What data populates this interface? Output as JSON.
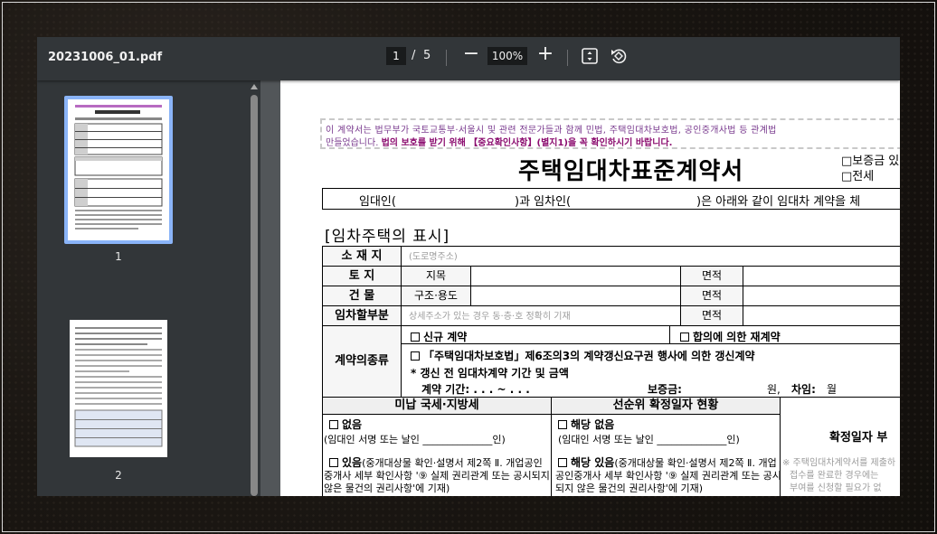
{
  "toolbar": {
    "file_name": "20231006_01.pdf",
    "current_page": "1",
    "page_separator": "/",
    "total_pages": "5",
    "zoom_minus": "−",
    "zoom": "100%",
    "zoom_plus": "+"
  },
  "sidebar": {
    "thumbnails": [
      {
        "label": "1",
        "selected": true
      },
      {
        "label": "2",
        "selected": false
      }
    ]
  },
  "document": {
    "notice_line1": "이 계약서는 법무부가 국토교통부·서울시 및 관련 전문가들과 함께 민법, 주택임대차보호법, 공인중개사법 등 관계법",
    "notice_line2a": "만들었습니다.",
    "notice_line2b": "법의 보호를 받기 위해 【중요확인사항】(별지1)을 꼭 확인하시기 바랍니다.",
    "title": "주택임대차표준계약서",
    "option_deposit": "□보증금 있",
    "option_jeonse": "□전세",
    "parties_lessor": "임대인(",
    "parties_and": ")과 임차인(",
    "parties_rest": ")은 아래와 같이 임대차 계약을 체",
    "section_title": "[임차주택의 표시]",
    "table": {
      "location_label": "소 재 지",
      "location_placeholder": "(도로명주소)",
      "land_label": "토   지",
      "land_category": "지목",
      "area_label": "면적",
      "building_label": "건   물",
      "building_structure": "구조·용도",
      "rental_part_label": "임차할부분",
      "rental_part_placeholder": "상세주소가 있는 경우 동·층·호 정확히 기재",
      "contract_type_label": "계약의종류",
      "new_contract": "신규 계약",
      "mutual_renewal": "합의에 의한 재계약",
      "renewal_right": "「주택임대차보호법」제6조의3의 계약갱신요구권 행사에 의한 갱신계약",
      "prior_terms": "* 갱신 전 임대차계약 기간 및 금액",
      "contract_period": "계약 기간:    .    .   .  ~    .    .    .",
      "deposit": "보증금:",
      "won": "원,",
      "rent": "차임:",
      "month": "월",
      "tax_header": "미납 국세·지방세",
      "priority_header": "선순위 확정일자 현황",
      "none": "없음",
      "lessor_sign": "(임대인 서명 또는 날인 ______________인)",
      "priority_none": "해당 없음",
      "exists": "있음",
      "exists_detail1": "(중개대상물 확인·설명서 제2쪽 Ⅱ. 개업공인",
      "exists_detail2": "중개사 세부 확인사항 '⑨ 실제 권리관계 또는 공시되지",
      "exists_detail3": "않은 물건의 권리사항'에 기재)",
      "priority_exists": "해당 있음",
      "priority_detail1": "(중개대상물 확인·설명서 제2쪽 Ⅱ. 개업",
      "priority_detail2": "공인중개사 세부 확인사항 '⑨ 실제 권리관계 또는 공시",
      "priority_detail3": "되지 않은 물건의 권리사항'에 기재)",
      "confirm_date_header": "확정일자 부",
      "confirm_note1": "※ 주택임대차계약서를 제출하",
      "confirm_note2": "접수를 완료한 경우에는",
      "confirm_note3": "부여를 신청할 필요가 없"
    }
  }
}
